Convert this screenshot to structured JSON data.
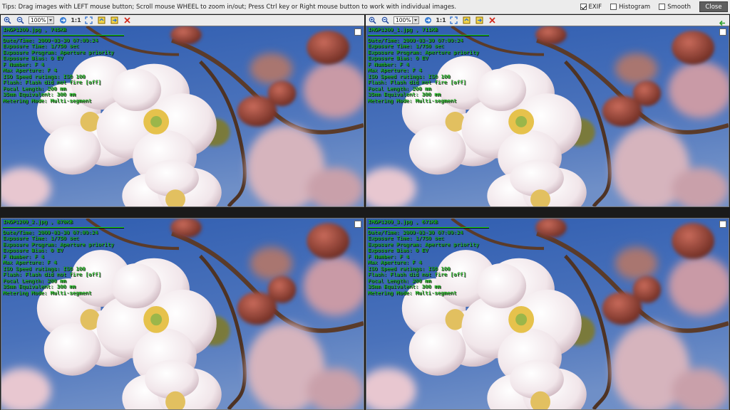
{
  "window": {
    "tips": "Tips: Drag images with LEFT mouse button; Scroll mouse WHEEL to zoom in/out; Press Ctrl key or Right mouse button to work with individual images.",
    "options": [
      {
        "label": "EXIF",
        "checked": true
      },
      {
        "label": "Histogram",
        "checked": false
      },
      {
        "label": "Smooth",
        "checked": false
      }
    ],
    "close_label": "Close"
  },
  "icons": {
    "zoom_in": "zoom-in-icon",
    "zoom_out": "zoom-out-icon",
    "fit": "fit-screen-icon",
    "prev": "previous-icon",
    "next": "next-icon",
    "delete": "delete-icon",
    "back": "back-arrow-icon",
    "navigate": "navigate-icon"
  },
  "colors": {
    "exif_text": "#1ee61e",
    "sky": "#3f66b2",
    "close_button": "#5e5e5e"
  },
  "panels": [
    {
      "zoom": "100%",
      "one_to_one": "1:1",
      "header": "IMGP1209.jpg , 745KB",
      "exif": [
        "Date/Time: 2009-03-30 07:09:24",
        "Exposure Time: 1/750 sec",
        "Exposure Program: Aperture priority",
        "Exposure Bias: 0 EV",
        "F Number: F 4",
        "Max Aperture: F 4",
        "ISO Speed ratings: ISO 100",
        "Flash: Flash did not fire [off]",
        "Focal Length: 200 mm",
        "35mm Equivalent: 300 mm",
        "Metering Mode: Multi-segment"
      ]
    },
    {
      "zoom": "100%",
      "one_to_one": "1:1",
      "header": "IMGP1209_1.jpg , 711KB",
      "exif": [
        "Date/Time: 2009-03-30 07:09:24",
        "Exposure Time: 1/750 sec",
        "Exposure Program: Aperture priority",
        "Exposure Bias: 0 EV",
        "F Number: F 4",
        "Max Aperture: F 4",
        "ISO Speed ratings: ISO 100",
        "Flash: Flash did not fire [off]",
        "Focal Length: 200 mm",
        "35mm Equivalent: 300 mm",
        "Metering Mode: Multi-segment"
      ]
    },
    {
      "header": "IMGP1209_2.jpg , 870KB",
      "exif": [
        "Date/Time: 2009-03-30 07:09:24",
        "Exposure Time: 1/750 sec",
        "Exposure Program: Aperture priority",
        "Exposure Bias: 0 EV",
        "F Number: F 4",
        "Max Aperture: F 4",
        "ISO Speed ratings: ISO 100",
        "Flash: Flash did not fire [off]",
        "Focal Length: 200 mm",
        "35mm Equivalent: 300 mm",
        "Metering Mode: Multi-segment"
      ]
    },
    {
      "header": "IMGP1209_3.jpg , 671KB",
      "exif": [
        "Date/Time: 2009-03-30 07:09:24",
        "Exposure Time: 1/750 sec",
        "Exposure Program: Aperture priority",
        "Exposure Bias: 0 EV",
        "F Number: F 4",
        "Max Aperture: F 4",
        "ISO Speed ratings: ISO 100",
        "Flash: Flash did not fire [off]",
        "Focal Length: 200 mm",
        "35mm Equivalent: 300 mm",
        "Metering Mode: Multi-segment"
      ]
    }
  ]
}
